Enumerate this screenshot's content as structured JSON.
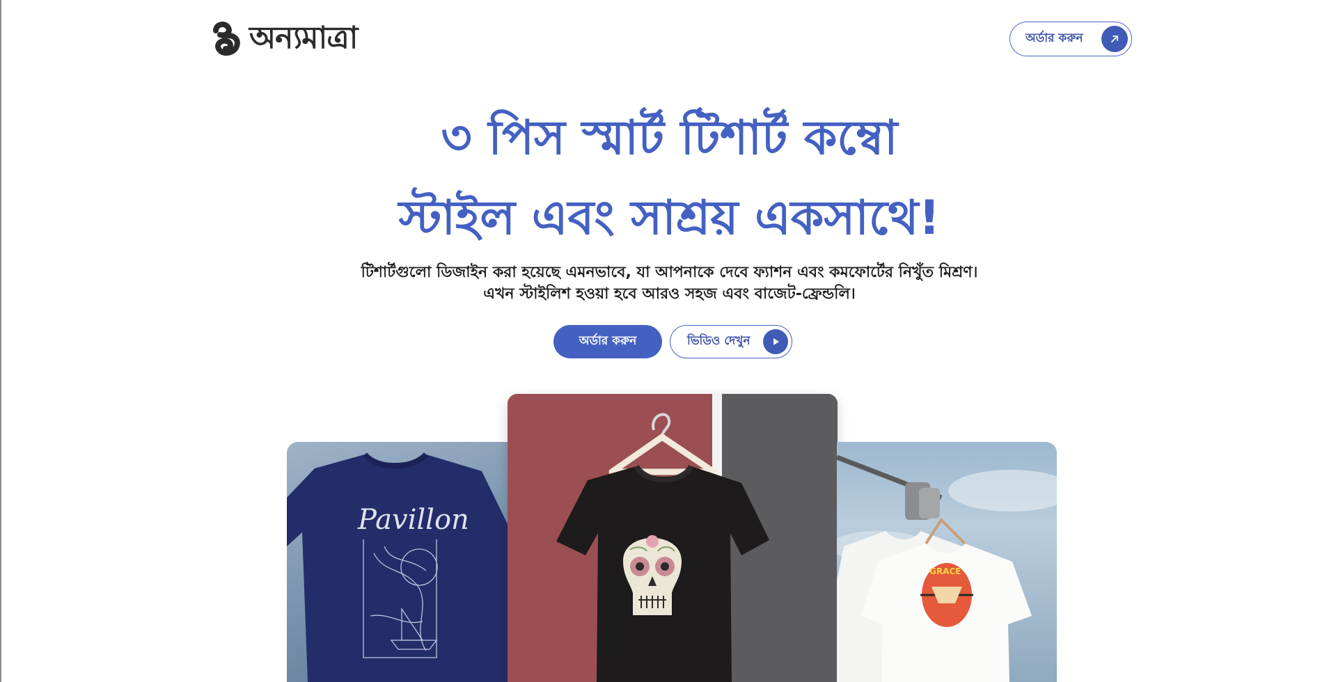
{
  "brand": {
    "name": "অন্যমাত্রা"
  },
  "header": {
    "order_label": "অর্ডার করুন"
  },
  "hero": {
    "title_line1": "৩ পিস স্মার্ট টিশার্ট কম্বো",
    "title_line2": "স্টাইল এবং সাশ্রয় একসাথে!",
    "subtitle_line1": "টিশার্টগুলো ডিজাইন করা হয়েছে এমনভাবে, যা আপনাকে দেবে ফ্যাশন এবং কমফোর্টের নিখুঁত মিশ্রণ।",
    "subtitle_line2": "এখন স্টাইলিশ হওয়া হবে আরও সহজ এবং বাজেট-ফ্রেন্ডলি।",
    "order_button": "অর্ডার করুন",
    "video_button": "ভিডিও দেখুন"
  },
  "gallery": {
    "left_print_text": "Pavillon",
    "right_print_text": "GRACE"
  },
  "colors": {
    "accent": "#4461c2",
    "card_red": "#9c4f52",
    "card_gray": "#5c5b5d"
  }
}
